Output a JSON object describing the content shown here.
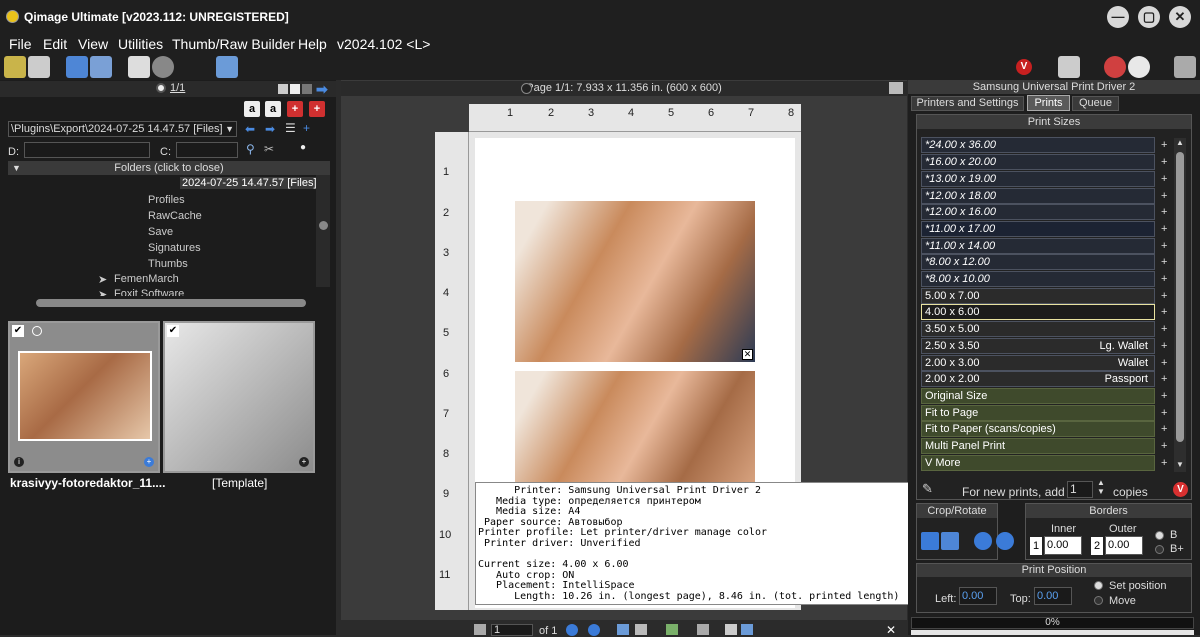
{
  "window": {
    "title": "Qimage Ultimate [v2023.112: UNREGISTERED]",
    "minimize": "—",
    "maximize": "▢",
    "close": "✕"
  },
  "menu": [
    "File",
    "Edit",
    "View",
    "Utilities",
    "Thumb/Raw Builder",
    "Help",
    "v2024.102 <L>"
  ],
  "left_panel": {
    "page_counter": "1/1",
    "path": "\\Plugins\\Export\\2024-07-25 14.47.57 [Files]",
    "d_label": "D:",
    "c_label": "C:",
    "folders_header": "Folders (click to close)",
    "tree": [
      "2024-07-25 14.47.57 [Files]",
      "Profiles",
      "RawCache",
      "Save",
      "Signatures",
      "Thumbs",
      "FemenMarch",
      "Foxit Software"
    ],
    "thumbs": [
      {
        "label": "krasivyy-fotoredaktor_11....",
        "checked": true
      },
      {
        "label": "[Template]",
        "checked": true
      }
    ]
  },
  "center": {
    "page_header": "Page 1/1: 7.933 x 11.356 in.  (600 x 600)",
    "ruler_top": [
      "1",
      "2",
      "3",
      "4",
      "5",
      "6",
      "7",
      "8"
    ],
    "ruler_left": [
      "1",
      "2",
      "3",
      "4",
      "5",
      "6",
      "7",
      "8",
      "9",
      "10",
      "11"
    ],
    "tooltip_lines": [
      "      Printer: Samsung Universal Print Driver 2",
      "   Media type: определяется принтером",
      "   Media size: A4",
      " Paper source: Автовыбор",
      "Printer profile: Let printer/driver manage color",
      " Printer driver: Unverified",
      "",
      "Current size: 4.00 x 6.00",
      "   Auto crop: ON",
      "   Placement: IntelliSpace",
      "      Length: 10.26 in. (longest page), 8.46 in. (tot. printed length)"
    ],
    "page_input": "1",
    "page_of": "of 1"
  },
  "right_panel": {
    "printer_title": "Samsung Universal Print Driver 2",
    "tabs": [
      "Printers and Settings",
      "Prints",
      "Queue"
    ],
    "active_tab": "Prints",
    "sizes_header": "Print Sizes",
    "sizes": [
      {
        "label": "*24.00 x 36.00",
        "extra": ""
      },
      {
        "label": "*16.00 x 20.00",
        "extra": ""
      },
      {
        "label": "*13.00 x 19.00",
        "extra": ""
      },
      {
        "label": "*12.00 x 18.00",
        "extra": ""
      },
      {
        "label": "*12.00 x 16.00",
        "extra": ""
      },
      {
        "label": "*11.00 x 17.00",
        "extra": ""
      },
      {
        "label": "*11.00 x 14.00",
        "extra": ""
      },
      {
        "label": "*8.00 x 12.00",
        "extra": ""
      },
      {
        "label": "*8.00 x 10.00",
        "extra": ""
      },
      {
        "label": "5.00 x 7.00",
        "extra": ""
      },
      {
        "label": "4.00 x 6.00",
        "extra": ""
      },
      {
        "label": "3.50 x 5.00",
        "extra": ""
      },
      {
        "label": "2.50 x 3.50",
        "extra": "Lg. Wallet"
      },
      {
        "label": "2.00 x 3.00",
        "extra": "Wallet"
      },
      {
        "label": "2.00 x 2.00",
        "extra": "Passport"
      }
    ],
    "options": [
      "Original Size",
      "Fit to Page",
      "Fit to Paper (scans/copies)",
      "Multi Panel Print",
      "V More"
    ],
    "selected_size": "4.00 x 6.00",
    "new_prints_label": "For new prints, add",
    "copies_value": "1",
    "copies_label": "copies",
    "crop_rotate": "Crop/Rotate",
    "borders": "Borders",
    "inner": "Inner",
    "outer": "Outer",
    "inner_index": "1",
    "inner_value": "0.00",
    "outer_index": "2",
    "outer_value": "0.00",
    "b_label": "B",
    "bplus_label": "B+",
    "print_position": "Print Position",
    "left_label": "Left:",
    "left_value": "0.00",
    "top_label": "Top:",
    "top_value": "0.00",
    "set_position": "Set position",
    "move": "Move",
    "progress_label": "0%",
    "progress": 0
  },
  "colors": {
    "accent_blue": "#3b7bd8",
    "red": "#d83030",
    "selection": "#e8e2a0"
  }
}
